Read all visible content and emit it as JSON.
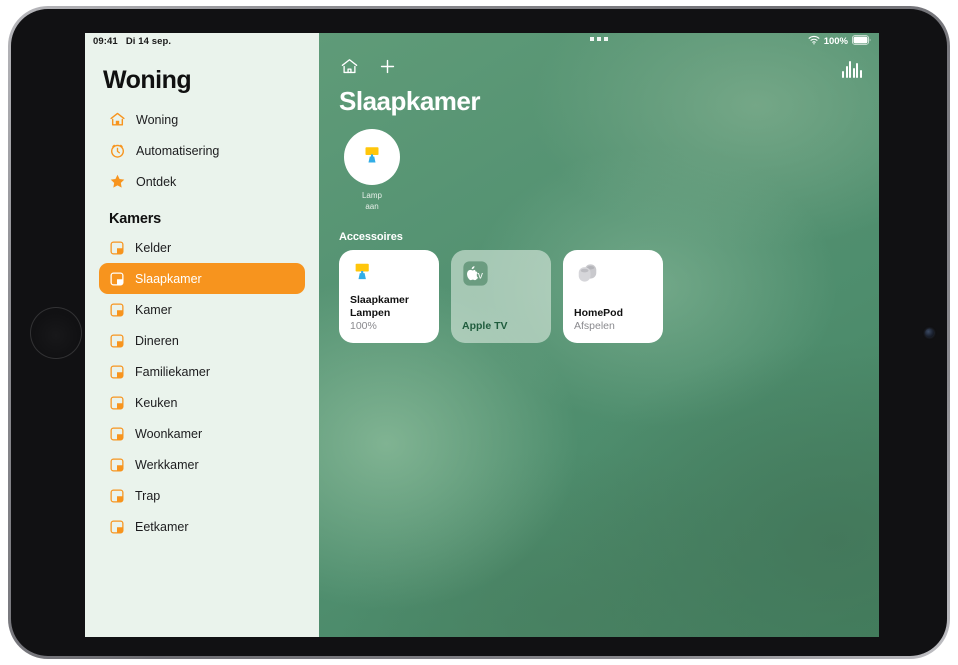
{
  "status_bar": {
    "time": "09:41",
    "date": "Di 14 sep.",
    "battery_percent": "100%",
    "wifi_icon": "wifi-icon",
    "battery_icon": "battery-icon"
  },
  "sidebar": {
    "title": "Woning",
    "nav": [
      {
        "label": "Woning",
        "icon": "house-icon"
      },
      {
        "label": "Automatisering",
        "icon": "clock-automation-icon"
      },
      {
        "label": "Ontdek",
        "icon": "star-icon"
      }
    ],
    "section_header": "Kamers",
    "rooms": [
      {
        "label": "Kelder",
        "icon": "room-icon",
        "selected": false
      },
      {
        "label": "Slaapkamer",
        "icon": "room-icon",
        "selected": true
      },
      {
        "label": "Kamer",
        "icon": "room-icon",
        "selected": false
      },
      {
        "label": "Dineren",
        "icon": "room-icon",
        "selected": false
      },
      {
        "label": "Familiekamer",
        "icon": "room-icon",
        "selected": false
      },
      {
        "label": "Keuken",
        "icon": "room-icon",
        "selected": false
      },
      {
        "label": "Woonkamer",
        "icon": "room-icon",
        "selected": false
      },
      {
        "label": "Werkkamer",
        "icon": "room-icon",
        "selected": false
      },
      {
        "label": "Trap",
        "icon": "room-icon",
        "selected": false
      },
      {
        "label": "Eetkamer",
        "icon": "room-icon",
        "selected": false
      }
    ]
  },
  "main": {
    "toolbar": {
      "home_icon": "house-icon",
      "add_icon": "plus-icon",
      "airplay_icon": "audio-waveform-icon"
    },
    "room_title": "Slaapkamer",
    "favourite": {
      "icon": "lamp-icon",
      "name": "Lamp",
      "state": "aan"
    },
    "accessories_header": "Accessoires",
    "accessories": [
      {
        "name": "Slaapkamer Lampen",
        "name_line1": "Slaapkamer",
        "name_line2": "Lampen",
        "state": "100%",
        "icon": "lamp-icon",
        "active": true
      },
      {
        "name": "Apple TV",
        "name_line1": "Apple TV",
        "name_line2": "",
        "state": "",
        "icon": "apple-tv-icon",
        "active": false
      },
      {
        "name": "HomePod",
        "name_line1": "HomePod",
        "name_line2": "",
        "state": "Afspelen",
        "icon": "homepod-icon",
        "active": true
      }
    ]
  },
  "colors": {
    "accent_orange": "#f7941e",
    "sidebar_bg": "#eaf3ec",
    "wallpaper_green": "#4e8d6d",
    "lamp_shade": "#ffc60b",
    "lamp_base": "#32ade6"
  }
}
